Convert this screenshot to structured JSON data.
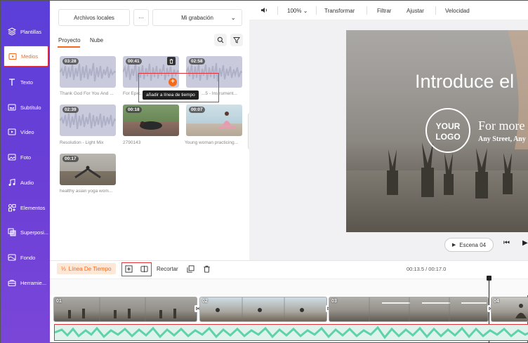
{
  "sidebar": {
    "items": [
      {
        "label": "Plantillas",
        "icon": "template-icon"
      },
      {
        "label": "Medios",
        "icon": "media-folder-icon",
        "active": true
      },
      {
        "label": "Texto",
        "icon": "text-icon"
      },
      {
        "label": "Subtítulo",
        "icon": "subtitle-icon"
      },
      {
        "label": "Vídeo",
        "icon": "video-icon"
      },
      {
        "label": "Foto",
        "icon": "photo-icon"
      },
      {
        "label": "Audio",
        "icon": "music-icon"
      },
      {
        "label": "Elementos",
        "icon": "elements-icon"
      },
      {
        "label": "Superposi...",
        "icon": "overlay-icon"
      },
      {
        "label": "Fondo",
        "icon": "background-icon"
      },
      {
        "label": "Herramie...",
        "icon": "toolbox-icon"
      }
    ]
  },
  "media": {
    "source_button": "Archivos locales",
    "more_button": "···",
    "recording_select": "Mi grabación",
    "tabs": [
      "Proyecto",
      "Nube"
    ],
    "tooltip": "añadir a línea de tiempo",
    "items": [
      {
        "duration": "03:28",
        "caption": "Thank God For You And ...",
        "type": "audio"
      },
      {
        "duration": "00:41",
        "caption": "For Epic...",
        "type": "audio"
      },
      {
        "duration": "02:58",
        "caption": "...5 - Instrument...",
        "type": "audio"
      },
      {
        "duration": "02:39",
        "caption": "Resolution - Light Mix",
        "type": "audio"
      },
      {
        "duration": "00:18",
        "caption": "2790143",
        "type": "video"
      },
      {
        "duration": "00:07",
        "caption": "Young woman practicing...",
        "type": "video"
      },
      {
        "duration": "00:17",
        "caption": "healthy asian yoga wom...",
        "type": "video"
      }
    ]
  },
  "preview": {
    "toolbar": {
      "zoom": "100%",
      "transform": "Transformar",
      "filter": "Filtrar",
      "adjust": "Ajustar",
      "speed": "Velocidad"
    },
    "canvas": {
      "title": "Introduce el",
      "logo_line1": "YOUR",
      "logo_line2": "LOGO",
      "sub1": "For more",
      "sub2": "Any Street, Any"
    },
    "scene": "Escena 04"
  },
  "timeline": {
    "label": "Línea De Tiempo",
    "crop": "Recortar",
    "time": "00:13.5 / 00:17.0",
    "clips": [
      "01",
      "02",
      "03",
      "04"
    ]
  },
  "colors": {
    "accent": "#f36a1d",
    "sidebar": "#6a3fd6",
    "highlight": "#e0333a",
    "audio_wave": "#5fd3a8"
  }
}
